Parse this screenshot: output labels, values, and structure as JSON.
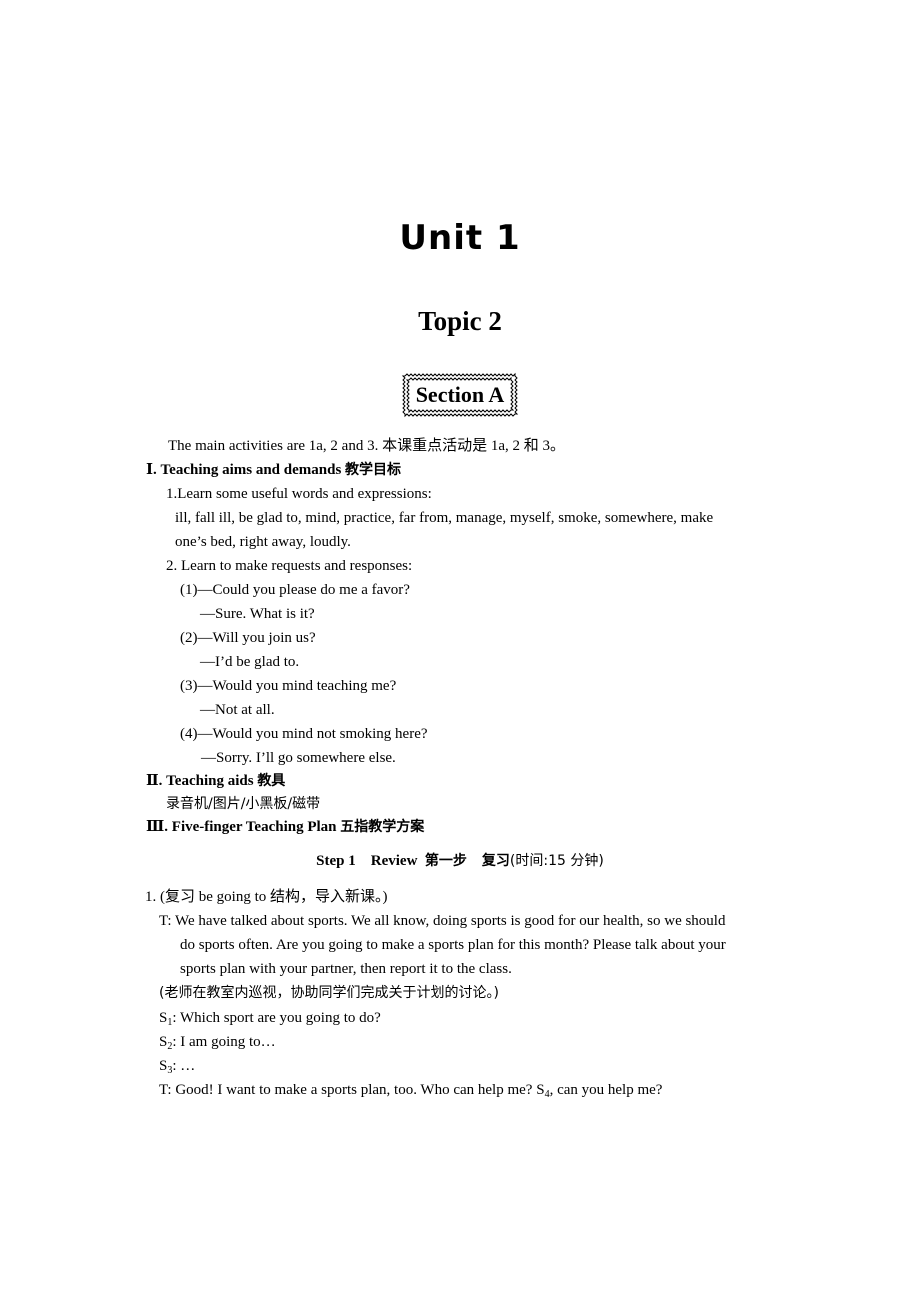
{
  "unit_title": "Unit 1",
  "topic_title": "Topic 2",
  "section_label": "Section A",
  "intro": "The main activities are 1a, 2 and 3.  本课重点活动是 1a, 2 和 3。",
  "part1": {
    "numeral": "Ⅰ.",
    "title": "Teaching aims and demands",
    "title_cn": "教学目标",
    "item1_heading": "1.Learn some useful words and expressions:",
    "item1_words_line1": "ill, fall ill, be glad to, mind, practice, far from, manage, myself, smoke, somewhere, make",
    "item1_words_line2": "one’s bed, right away, loudly.",
    "item2_heading": "2. Learn to make requests and responses:",
    "dialogues": [
      {
        "num": "(1)",
        "q": "—Could you please do me a favor?",
        "a": "—Sure. What is it?"
      },
      {
        "num": "(2)",
        "q": "—Will you join us?",
        "a": "—I’d be glad to."
      },
      {
        "num": "(3)",
        "q": "—Would you mind teaching me?",
        "a": "—Not at all."
      },
      {
        "num": "(4)",
        "q": "—Would you mind not smoking here?",
        "a": "—Sorry. I’ll go somewhere else."
      }
    ]
  },
  "part2": {
    "numeral": "Ⅱ.",
    "title": "Teaching aids",
    "title_cn": "教具",
    "content": "录音机/图片/小黑板/磁带"
  },
  "part3": {
    "numeral": "Ⅲ.",
    "title": "Five-finger Teaching Plan",
    "title_cn": "五指教学方案"
  },
  "step1": {
    "label": "Step 1",
    "name": "Review",
    "label_cn": "第一步",
    "name_cn": "复习",
    "time": "(时间:15 分钟)"
  },
  "activity1": {
    "heading": "1. (复习 be going to 结构，导入新课。)",
    "t_line1": "T: We have talked about sports. We all know, doing sports is good for our health, so we should",
    "t_line2": "do sports often. Are you going to make a sports plan for this month? Please talk about your",
    "t_line3": "sports plan with your partner, then report it to the class.",
    "note": "(老师在教室内巡视，协助同学们完成关于计划的讨论。)",
    "s1_speaker": "S",
    "s1_sub": "1",
    "s1_text": ": Which sport are you going to do?",
    "s2_speaker": "S",
    "s2_sub": "2",
    "s2_text": ": I am going to…",
    "s3_speaker": "S",
    "s3_sub": "3",
    "s3_text": ": …",
    "t2_text_a": "T:  Good! I want to make a sports plan, too. Who can help me? S",
    "t2_sub": "4",
    "t2_text_b": ", can you help me?"
  }
}
